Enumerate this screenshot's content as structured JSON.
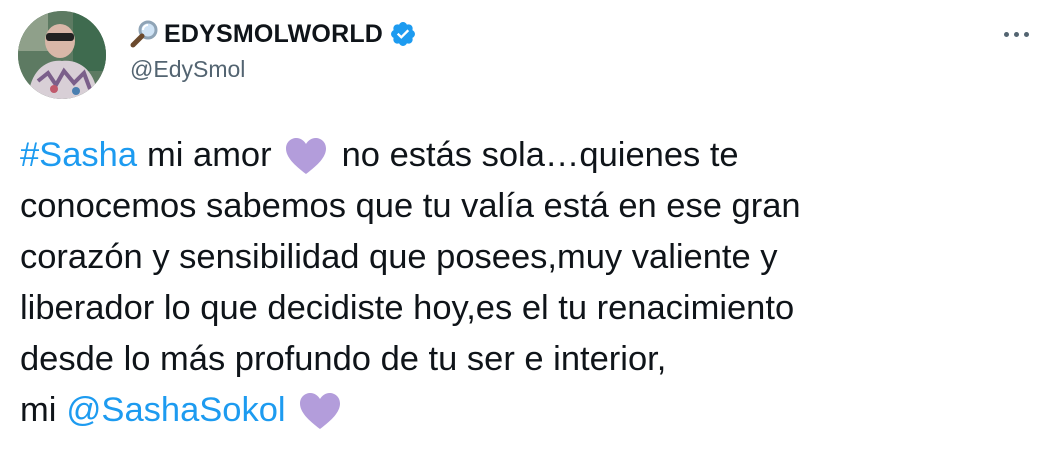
{
  "author": {
    "display_name": "EDYSMOLWORLD",
    "handle": "@EdySmol",
    "verified": true,
    "name_prefix_icon": "magnifying-glass-icon",
    "verified_icon": "verified-badge-icon",
    "accent_color": "#1d9bf0"
  },
  "menu": {
    "icon": "more-horizontal-icon"
  },
  "tweet": {
    "line1": {
      "hashtag": "#Sasha",
      "before_heart": "mi amor",
      "after_heart": "no estás sola…quienes te"
    },
    "line2": "conocemos sabemos que tu valía está en ese gran",
    "line3": "corazón y sensibilidad que posees,muy valiente y",
    "line4": "liberador lo que decidiste hoy,es el tu renacimiento",
    "line5": "desde lo más profundo de tu ser e interior,",
    "line6": {
      "before_mention": "mi",
      "mention": "@SashaSokol"
    },
    "emoji": "purple-heart-icon",
    "emoji_color": "#b39ddb"
  }
}
